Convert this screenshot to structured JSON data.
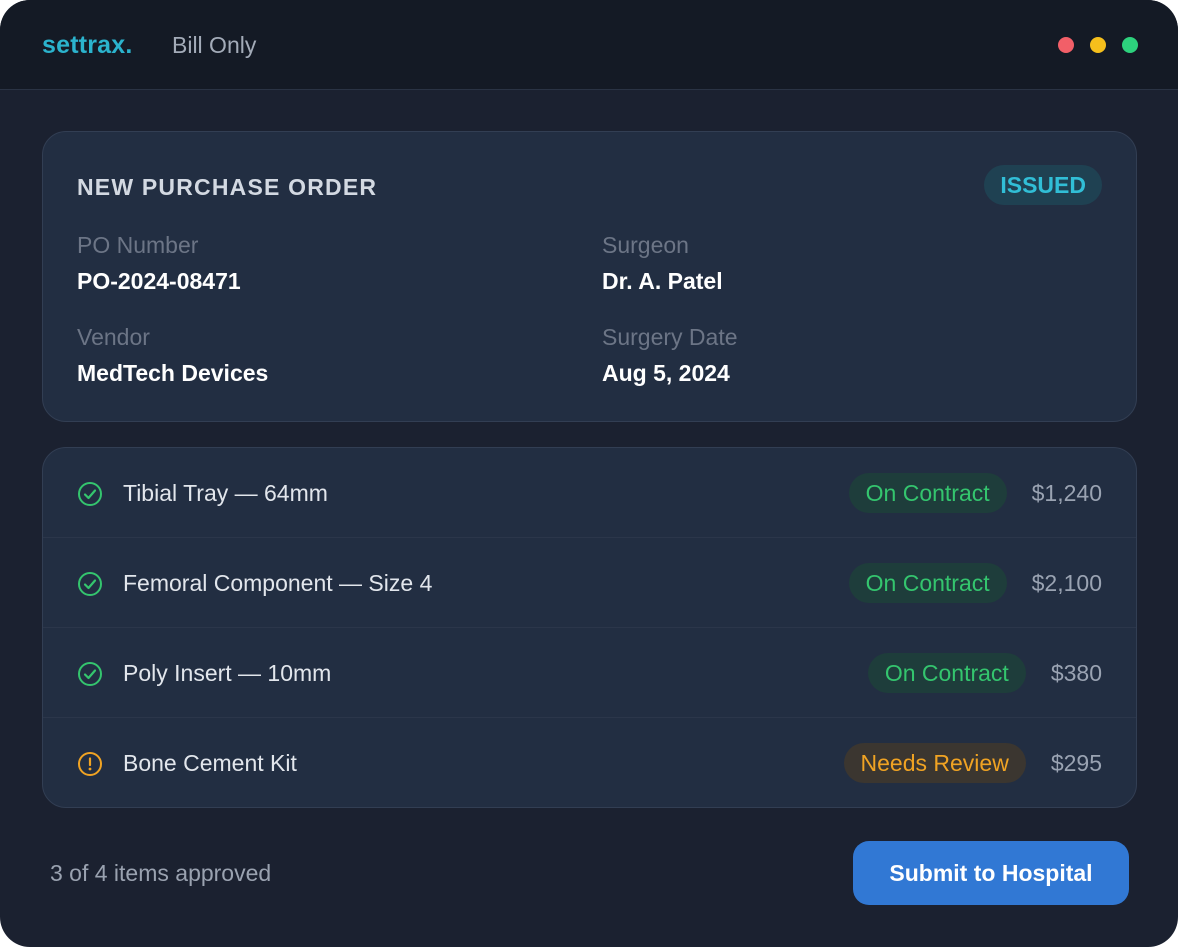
{
  "app": {
    "logo": "settrax.",
    "title": "Bill Only"
  },
  "window_controls": [
    "close",
    "minimize",
    "maximize"
  ],
  "po": {
    "heading": "NEW PURCHASE ORDER",
    "status": "ISSUED",
    "fields": {
      "po_number": {
        "label": "PO Number",
        "value": "PO-2024-08471"
      },
      "surgeon": {
        "label": "Surgeon",
        "value": "Dr. A. Patel"
      },
      "vendor": {
        "label": "Vendor",
        "value": "MedTech Devices"
      },
      "surgery_date": {
        "label": "Surgery Date",
        "value": "Aug 5, 2024"
      }
    }
  },
  "items": [
    {
      "name": "Tibial Tray — 64mm",
      "status": "On Contract",
      "price": "$1,240",
      "icon": "check-circle-icon"
    },
    {
      "name": "Femoral Component — Size 4",
      "status": "On Contract",
      "price": "$2,100",
      "icon": "check-circle-icon"
    },
    {
      "name": "Poly Insert — 10mm",
      "status": "On Contract",
      "price": "$380",
      "icon": "check-circle-icon"
    },
    {
      "name": "Bone Cement Kit",
      "status": "Needs Review",
      "price": "$295",
      "icon": "alert-circle-icon"
    }
  ],
  "footer": {
    "summary": "3 of 4 items approved",
    "submit_label": "Submit to Hospital"
  },
  "colors": {
    "accent": "#2bb3cd",
    "approved": "#34c56e",
    "review": "#f0a323",
    "primary_button": "#3178d4"
  }
}
